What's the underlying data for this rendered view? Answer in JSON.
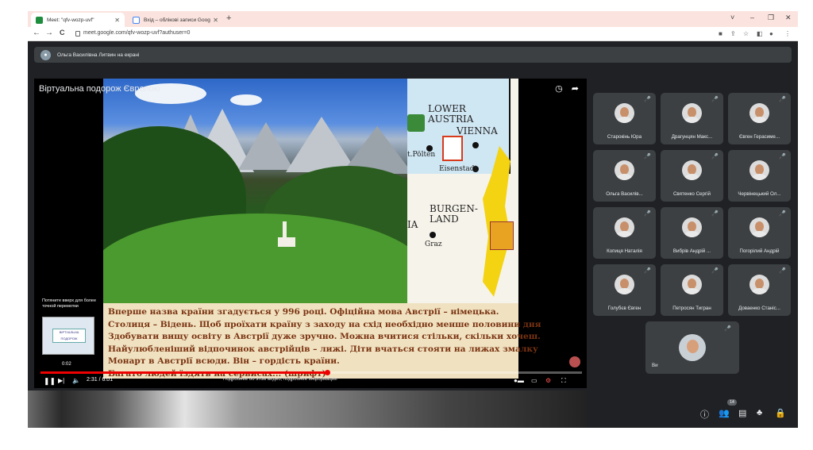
{
  "browser": {
    "tabs": [
      {
        "title": "Meet: \"qfv-wozp-uvf\"",
        "active": true,
        "favicon_color": "#1e8e3e"
      },
      {
        "title": "Вхід – облікові записи Google",
        "active": false,
        "favicon_color": "#4285f4"
      }
    ],
    "new_tab": "+",
    "window_controls": [
      "˅",
      "–",
      "❐",
      "✕"
    ],
    "url": "meet.google.com/qfv-wozp-uvf?authuser=0",
    "nav": {
      "back": "←",
      "forward": "→",
      "reload": "C"
    }
  },
  "meet": {
    "presenter_text": "Ольга Василівна Литвин на екрані",
    "video": {
      "title": "Віртуальна подорож Європою",
      "map_labels": {
        "lower_austria": "LOWER\nAUSTRIA",
        "vienna": "VIENNA",
        "polten": "t.Pölten",
        "eisenstadt": "Eisenstadt",
        "burgenland": "BURGEN-\nLAND",
        "ia": "IA",
        "graz": "Graz"
      },
      "caption_lines": [
        "Вперше назва країни згадується у 996 році. Офіційна мова Австрії – німецька.",
        "Столиця – Відень. Щоб проїхати країну з заходу на схід необхідно менше половини дня",
        "Здобувати вищу освіту в Австрії дуже зручно. Можна вчитися стільки, скільки хочеш.",
        "Найулюбленіший відпочинок австрійців – лижі. Діти вчаться стояти на лижах змалку",
        "Монарт в Австрії всюди. Він – гордість країни.",
        "Багато людей їздять на сервисах... (шрифт)"
      ],
      "hint": "Потяните вверх для более точной перемотки",
      "thumb_text": "ВІРТУАЛЬНА ПОДОРОЖ",
      "time_small": "0:02",
      "time_main": "2:31 / 6:01",
      "progress": 0.53,
      "ctrl_info": "Подробнее об этом видео, подробнее информации"
    },
    "participants": [
      {
        "name": "Старокінь Юра"
      },
      {
        "name": "Драгунцян Макс..."
      },
      {
        "name": "Євген Герасиме..."
      },
      {
        "name": "Ольга Василів..."
      },
      {
        "name": "Святенко Сергій"
      },
      {
        "name": "Червінецький Ол..."
      },
      {
        "name": "Копиця Наталія"
      },
      {
        "name": "Вибрів Андрій ..."
      },
      {
        "name": "Погорілий Андрій"
      },
      {
        "name": "Голубєв Євген"
      },
      {
        "name": "Петросян Тигран"
      },
      {
        "name": "Доваенко Станіс..."
      }
    ],
    "self_tile": {
      "name": "Ви"
    },
    "participant_count": "14",
    "toolbar_icons": [
      "info-icon",
      "people-icon",
      "chat-icon",
      "activities-icon",
      "lock-icon"
    ]
  }
}
